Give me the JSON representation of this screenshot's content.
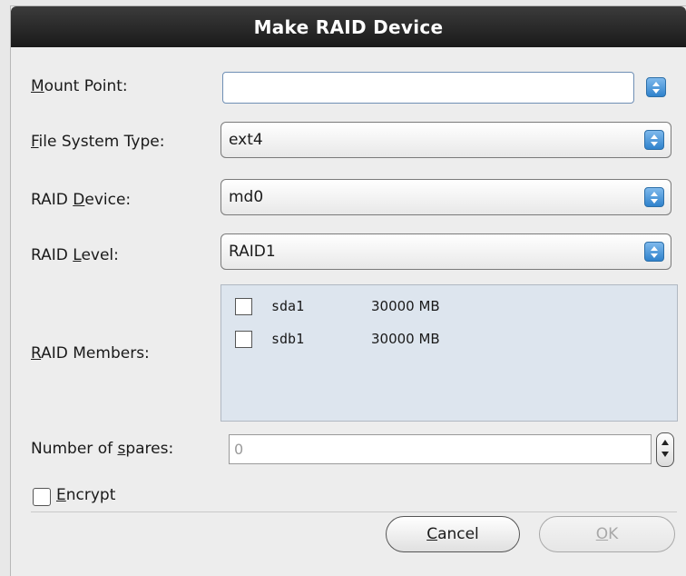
{
  "dialog": {
    "title": "Make RAID Device"
  },
  "fields": {
    "mount_point": {
      "label_pre": "",
      "label_u": "M",
      "label_post": "ount Point:",
      "value": ""
    },
    "fs_type": {
      "label_pre": "",
      "label_u": "F",
      "label_post": "ile System Type:",
      "value": "ext4"
    },
    "raid_device": {
      "label_pre": "RAID ",
      "label_u": "D",
      "label_post": "evice:",
      "value": "md0"
    },
    "raid_level": {
      "label_pre": "RAID ",
      "label_u": "L",
      "label_post": "evel:",
      "value": "RAID1"
    },
    "raid_members": {
      "label_pre": "",
      "label_u": "R",
      "label_post": "AID Members:"
    },
    "spares": {
      "label_pre": "Number of ",
      "label_u": "s",
      "label_post": "pares:",
      "value": "0"
    }
  },
  "members": [
    {
      "name": "sda1",
      "size": "30000 MB",
      "checked": false
    },
    {
      "name": "sdb1",
      "size": "30000 MB",
      "checked": false
    }
  ],
  "encrypt": {
    "label_u": "E",
    "label_post": "ncrypt",
    "checked": false
  },
  "buttons": {
    "cancel": {
      "label_u": "C",
      "label_post": "ancel"
    },
    "ok": {
      "label_u": "O",
      "label_post": "K",
      "enabled": false
    }
  },
  "icons": {
    "combo_arrow": "updown-arrows-icon",
    "spin_arrow": "spin-arrows-icon"
  },
  "colors": {
    "titlebar": "#1f1f1f",
    "combo_button": "#2f82cc",
    "members_bg": "#dde5ee"
  }
}
